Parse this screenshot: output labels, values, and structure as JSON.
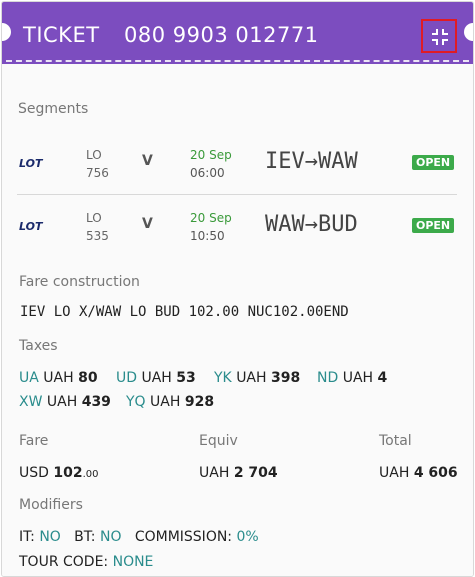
{
  "header": {
    "title": "TICKET",
    "ticket_number": "080 9903 012771",
    "collapse_icon": "collapse-icon",
    "bg_color": "#7c4dbf"
  },
  "segments": {
    "label": "Segments",
    "items": [
      {
        "airline_logo": "LOT",
        "carrier": "LO",
        "flight": "756",
        "class": "V",
        "date": "20 Sep",
        "time": "06:00",
        "route": "IEV→WAW",
        "status": "OPEN"
      },
      {
        "airline_logo": "LOT",
        "carrier": "LO",
        "flight": "535",
        "class": "V",
        "date": "20 Sep",
        "time": "10:50",
        "route": "WAW→BUD",
        "status": "OPEN"
      }
    ]
  },
  "fare_construction": {
    "label": "Fare construction",
    "value": "IEV LO X/WAW LO BUD 102.00 NUC102.00END"
  },
  "taxes": {
    "label": "Taxes",
    "items": [
      {
        "code": "UA",
        "currency": "UAH",
        "amount": "80"
      },
      {
        "code": "UD",
        "currency": "UAH",
        "amount": "53"
      },
      {
        "code": "YK",
        "currency": "UAH",
        "amount": "398"
      },
      {
        "code": "ND",
        "currency": "UAH",
        "amount": "4"
      },
      {
        "code": "XW",
        "currency": "UAH",
        "amount": "439"
      },
      {
        "code": "YQ",
        "currency": "UAH",
        "amount": "928"
      }
    ]
  },
  "amounts": {
    "fare": {
      "label": "Fare",
      "currency": "USD",
      "whole": "102",
      "cents": ".00"
    },
    "equiv": {
      "label": "Equiv",
      "currency": "UAH",
      "value": "2 704"
    },
    "total": {
      "label": "Total",
      "currency": "UAH",
      "value": "4 606"
    }
  },
  "modifiers": {
    "label": "Modifiers",
    "it": {
      "key": "IT:",
      "value": "NO"
    },
    "bt": {
      "key": "BT:",
      "value": "NO"
    },
    "commission": {
      "key": "COMMISSION:",
      "value": "0%"
    },
    "tour_code": {
      "key": "TOUR CODE:",
      "value": "NONE"
    }
  },
  "colors": {
    "accent": "#7c4dbf",
    "code": "#2a8c8c",
    "open_badge": "#3caa4a",
    "date": "#3a9a3a",
    "highlight_box": "#e01b24"
  }
}
